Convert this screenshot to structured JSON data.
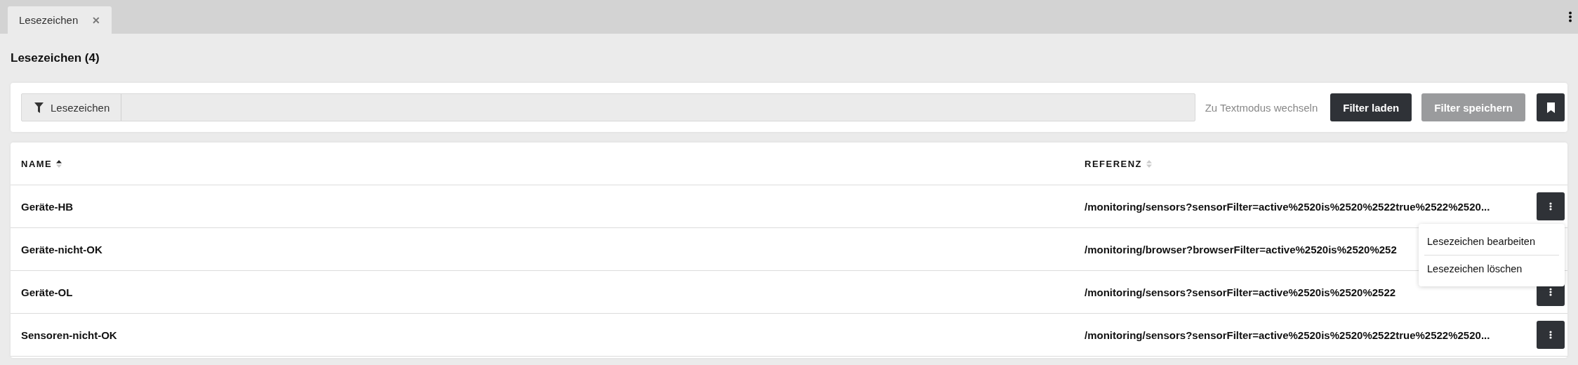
{
  "tabs": [
    {
      "label": "Lesezeichen",
      "selected": true,
      "close": "✕"
    }
  ],
  "page_title": "Lesezeichen (4)",
  "filter_bar": {
    "chip": "Lesezeichen",
    "text_mode_link": "Zu Textmodus wechseln",
    "buttons": [
      {
        "label": "Filter laden",
        "disabled": false
      },
      {
        "label": "Filter speichern",
        "disabled": true
      }
    ]
  },
  "table": {
    "columns": [
      {
        "label": "NAME",
        "sorted": true
      },
      {
        "label": "REFERENZ",
        "sorted": false
      }
    ],
    "rows": [
      {
        "name": "Geräte-HB",
        "reference": "/monitoring/sensors?sensorFilter=active%2520is%2520%2522true%2522%2520...",
        "menu_open": true
      },
      {
        "name": "Geräte-nicht-OK",
        "reference": "/monitoring/browser?browserFilter=active%2520is%2520%252"
      },
      {
        "name": "Geräte-OL",
        "reference": "/monitoring/sensors?sensorFilter=active%2520is%2520%2522"
      },
      {
        "name": "Sensoren-nicht-OK",
        "reference": "/monitoring/sensors?sensorFilter=active%2520is%2520%2522true%2522%2520..."
      }
    ],
    "context_menu": [
      "Lesezeichen bearbeiten",
      "Lesezeichen löschen"
    ]
  }
}
